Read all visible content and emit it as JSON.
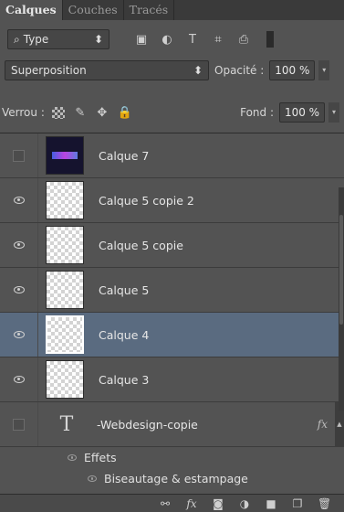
{
  "tabs": [
    {
      "label": "Calques",
      "active": true
    },
    {
      "label": "Couches",
      "active": false
    },
    {
      "label": "Tracés",
      "active": false
    }
  ],
  "filter": {
    "label": "Type",
    "search_icon": "⌕",
    "arrows": "⬍"
  },
  "filter_icons": {
    "image": "▣",
    "adjust": "◐",
    "text": "T",
    "shape": "⌗",
    "smart": "⎙"
  },
  "blend": {
    "mode": "Superposition",
    "arrows": "⬍",
    "opacity_label": "Opacité :",
    "opacity_value": "100 %",
    "arrow": "▾"
  },
  "lock": {
    "label": "Verrou :",
    "brush": "✎",
    "move": "✥",
    "lock": "🔒",
    "fill_label": "Fond :",
    "fill_value": "100 %",
    "arrow": "▾"
  },
  "layers": [
    {
      "name": "Calque 7",
      "visible": false,
      "thumb": "dark",
      "selected": false
    },
    {
      "name": "Calque 5 copie 2",
      "visible": true,
      "thumb": "transparent",
      "selected": false
    },
    {
      "name": "Calque 5 copie",
      "visible": true,
      "thumb": "transparent",
      "selected": false
    },
    {
      "name": "Calque 5",
      "visible": true,
      "thumb": "transparent",
      "selected": false
    },
    {
      "name": "Calque 4",
      "visible": true,
      "thumb": "transparent",
      "selected": true
    },
    {
      "name": "Calque 3",
      "visible": true,
      "thumb": "transparent",
      "selected": false
    }
  ],
  "type_layer": {
    "glyph": "T",
    "name": "-Webdesign-copie",
    "fx": "fx",
    "scroll": "▲"
  },
  "effects": {
    "label": "Effets",
    "sub_label": "Biseautage & estampage"
  },
  "bottom_bar": {
    "link": "⚯",
    "fx": "fx",
    "mask": "◙",
    "adjust": "◑",
    "folder": "■",
    "new": "❐",
    "trash": "🗑"
  }
}
